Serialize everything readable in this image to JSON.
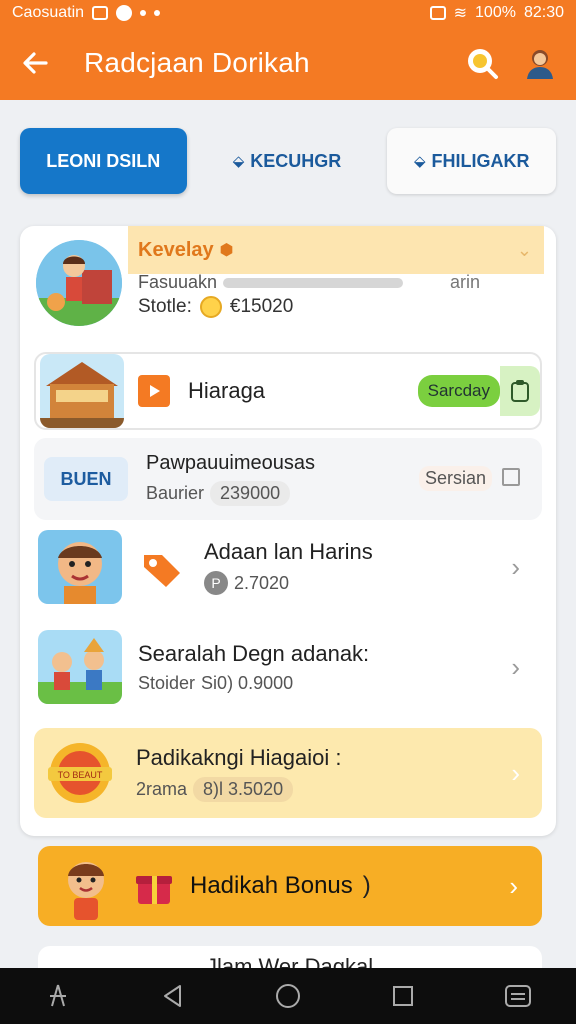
{
  "status_bar": {
    "left_text": "Caosuatin",
    "battery": "100%",
    "time": "82:30"
  },
  "app_bar": {
    "title": "Radcjaan Dorikah"
  },
  "tabs": [
    {
      "label": "LEONI DSILN",
      "state": "active"
    },
    {
      "label": "KECUHGR",
      "state": "plain"
    },
    {
      "label": "FHILIGAKR",
      "state": "boxed"
    }
  ],
  "profile": {
    "level_label": "Kevelay",
    "progress_label": "Fasuuakn",
    "progress_right": "arin",
    "stat_label": "Stotle:",
    "stat_value": "€15020"
  },
  "items": [
    {
      "name": "Hiaraga",
      "action_label": "Sarcday"
    },
    {
      "name": "Pawpauuimeousas",
      "thumb_label": "BUEN",
      "sub_label": "Baurier",
      "sub_value": "239000",
      "status": "Sersian"
    },
    {
      "name": "Adaan lan Harins",
      "sub_value": "2.7020",
      "coin_letter": "P"
    },
    {
      "name": "Searalah Degn adanak:",
      "sub_label": "Stoider",
      "sub_value": "Si0) 0.9000"
    },
    {
      "name": "Padikakngi Hiagaioi :",
      "sub_label": "2rama",
      "sub_value": "8)l 3.5020",
      "thumb_label": "TO BEAUT"
    }
  ],
  "bonus": {
    "label": "Hadikah Bonus",
    "suffix": ")"
  },
  "peek": {
    "label": "Jlam Wer Dagkal"
  },
  "colors": {
    "primary": "#f47a23",
    "tab_active": "#1577c9",
    "bonus": "#f7ae25",
    "highlight": "#fde9ae",
    "green": "#7bcf3f"
  },
  "icons": [
    "back-arrow-icon",
    "search-icon",
    "profile-icon",
    "lock-icon",
    "play-icon",
    "gift-icon",
    "chevron-right-icon"
  ]
}
